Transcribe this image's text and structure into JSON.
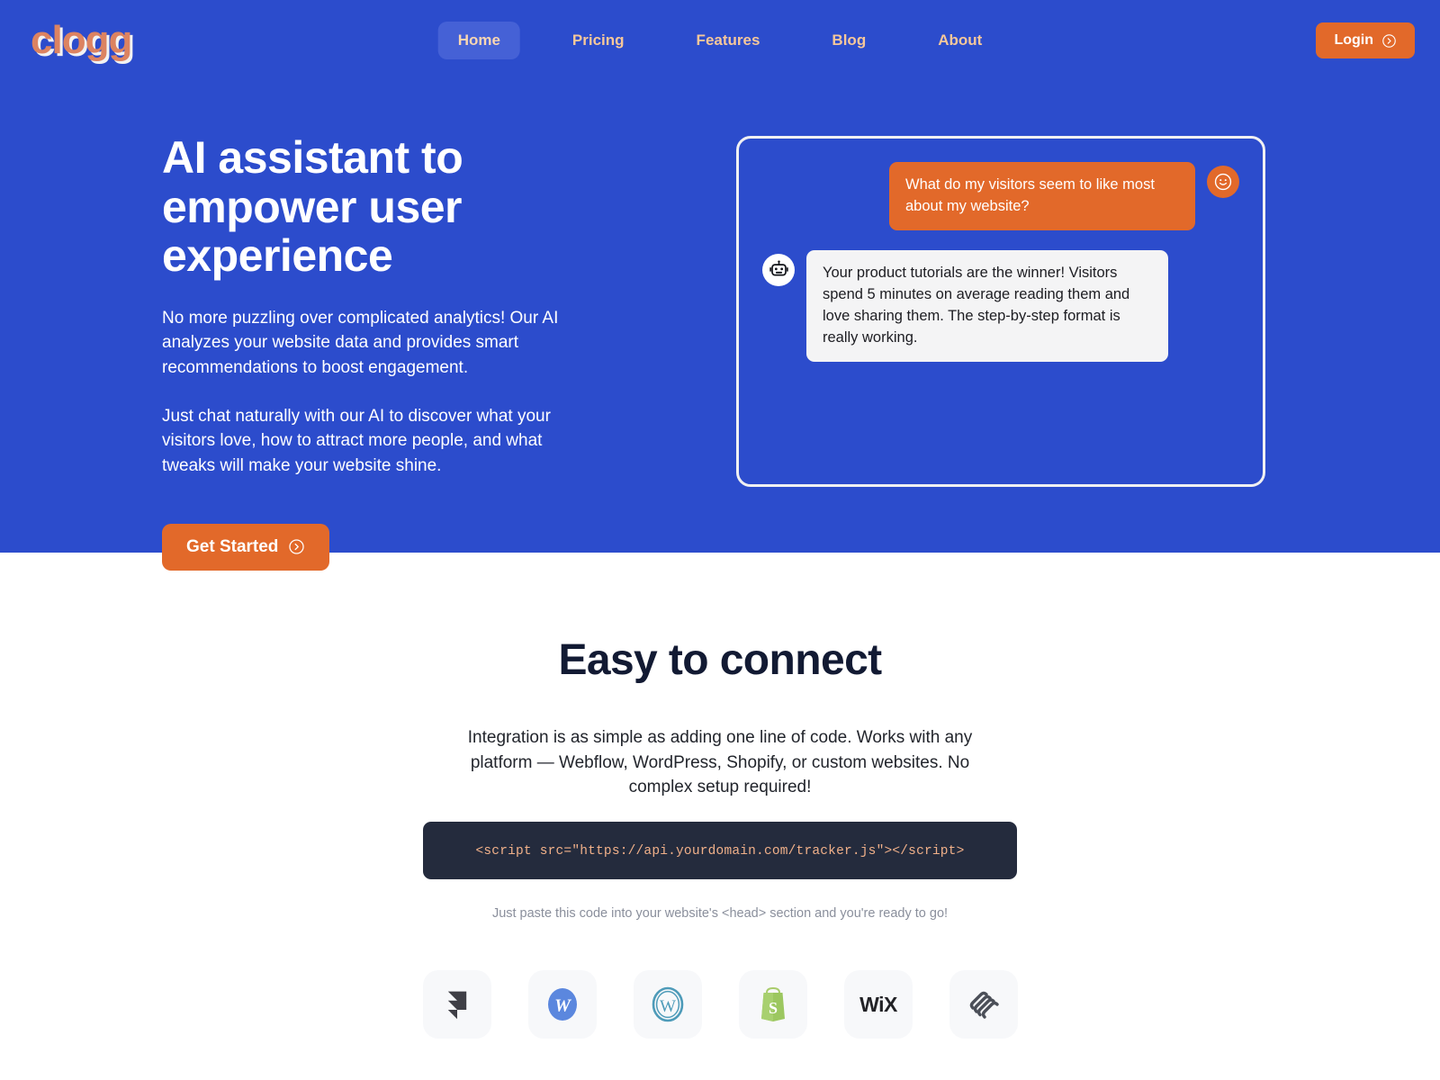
{
  "colors": {
    "hero_bg": "#2c4ccc",
    "accent_orange": "#e2692a",
    "logo_salmon": "#dc8361",
    "nav_link": "#f6c79a",
    "nav_active_bg": "#4561d6",
    "code_bg": "#242b3d",
    "code_text": "#f0b089",
    "dark_heading": "#121a33"
  },
  "nav": {
    "logo": "clogg",
    "links": [
      {
        "label": "Home",
        "active": true
      },
      {
        "label": "Pricing",
        "active": false
      },
      {
        "label": "Features",
        "active": false
      },
      {
        "label": "Blog",
        "active": false
      },
      {
        "label": "About",
        "active": false
      }
    ],
    "login_label": "Login",
    "login_icon": "arrow-right-circle-icon"
  },
  "hero": {
    "title": "AI assistant to empower user experience",
    "paragraph_1": "No more puzzling over complicated analytics! Our AI analyzes your website data and provides smart recommendations to boost engagement.",
    "paragraph_2": "Just chat naturally with our AI to discover what your visitors love, how to attract more people, and what tweaks will make your website shine.",
    "cta_label": "Get Started",
    "cta_icon": "arrow-right-circle-icon"
  },
  "chat": {
    "user_avatar_icon": "smiley-face-icon",
    "bot_avatar_icon": "robot-icon",
    "messages": [
      {
        "sender": "user",
        "text": "What do my visitors seem to like most about my website?"
      },
      {
        "sender": "bot",
        "text": "Your product tutorials are the winner! Visitors spend 5 minutes on average reading them and love sharing them. The step-by-step format is really working."
      }
    ]
  },
  "connect": {
    "title": "Easy to connect",
    "subtitle": "Integration is as simple as adding one line of code. Works with any platform — Webflow, WordPress, Shopify, or custom websites. No complex setup required!",
    "code_snippet": "<script src=\"https://api.yourdomain.com/tracker.js\"></script>",
    "code_note": "Just paste this code into your website's <head> section and you're ready to go!",
    "platforms": [
      {
        "name": "Framer",
        "icon": "framer-logo-icon"
      },
      {
        "name": "Webflow",
        "icon": "webflow-logo-icon"
      },
      {
        "name": "WordPress",
        "icon": "wordpress-logo-icon"
      },
      {
        "name": "Shopify",
        "icon": "shopify-logo-icon"
      },
      {
        "name": "Wix",
        "icon": "wix-logo-icon"
      },
      {
        "name": "Squarespace",
        "icon": "squarespace-logo-icon"
      }
    ]
  }
}
